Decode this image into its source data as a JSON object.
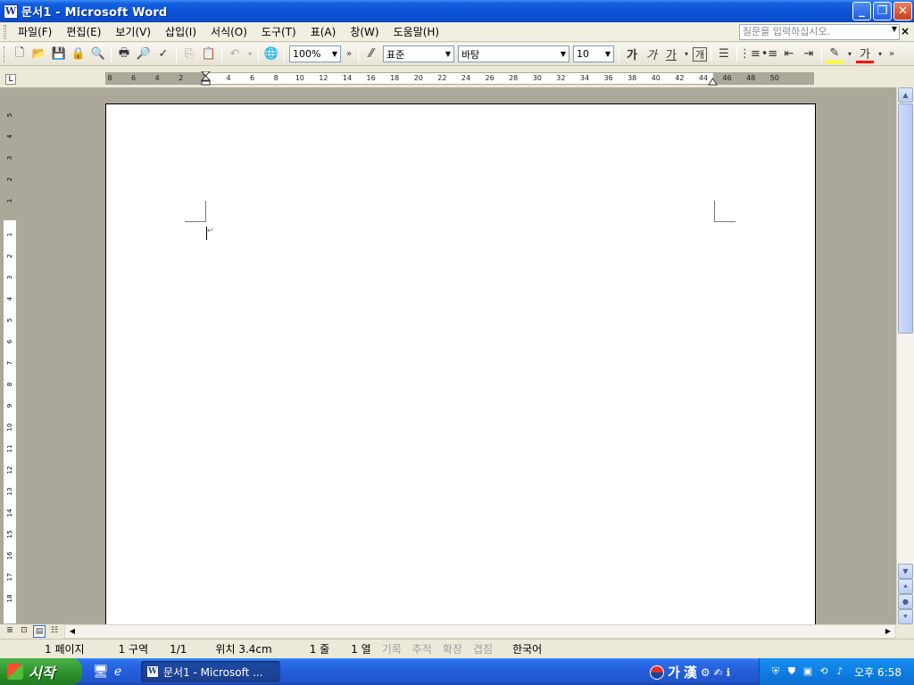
{
  "window": {
    "title": "문서1 - Microsoft Word",
    "app_icon_letter": "W"
  },
  "menubar": {
    "items": [
      "파일(F)",
      "편집(E)",
      "보기(V)",
      "삽입(I)",
      "서식(O)",
      "도구(T)",
      "표(A)",
      "창(W)",
      "도움말(H)"
    ],
    "help_placeholder": "질문을 입력하십시오.",
    "close_doc": "×"
  },
  "toolbar": {
    "zoom": "100%",
    "style": "표준",
    "font": "바탕",
    "size": "10",
    "bold_label": "가",
    "italic_label": "가",
    "underline_label": "가",
    "char_border_label": "개",
    "font_color_label": "가"
  },
  "ruler": {
    "tab_selector": "L",
    "h_ticks": [
      "8",
      "6",
      "4",
      "2",
      "2",
      "4",
      "6",
      "8",
      "10",
      "12",
      "14",
      "16",
      "18",
      "20",
      "22",
      "24",
      "26",
      "28",
      "30",
      "32",
      "34",
      "36",
      "38",
      "40",
      "42",
      "44",
      "46",
      "48",
      "50"
    ],
    "v_ticks": [
      "5",
      "4",
      "3",
      "2",
      "1",
      "1",
      "2",
      "3",
      "4",
      "5",
      "6",
      "7",
      "8",
      "9",
      "10",
      "11",
      "12",
      "13",
      "14",
      "15",
      "16",
      "17",
      "18"
    ]
  },
  "statusbar": {
    "page": "1 페이지",
    "section": "1 구역",
    "page_count": "1/1",
    "position": "위치 3.4cm",
    "line": "1 줄",
    "column": "1 열",
    "rec": "기록",
    "trk": "추적",
    "ext": "확장",
    "ovr": "겹침",
    "language": "한국어"
  },
  "taskbar": {
    "start_label": "시작",
    "task_label": "문서1 - Microsoft ...",
    "ime_label": "가",
    "ime_hanja": "漢",
    "clock": "오후 6:58"
  },
  "colors": {
    "titlebar": "#0b4fcf",
    "workspace": "#aca899",
    "taskbar": "#245edb",
    "start": "#2b8e2a"
  }
}
